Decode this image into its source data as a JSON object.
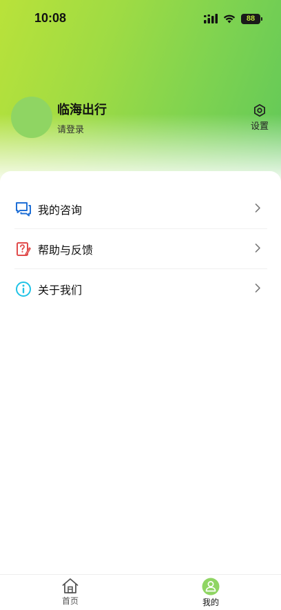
{
  "status_bar": {
    "time": "10:08",
    "battery": "88",
    "icons": [
      "cellular-signal-icon",
      "wifi-icon",
      "battery-icon"
    ]
  },
  "profile": {
    "name": "临海出行",
    "login_prompt": "请登录",
    "avatar_color": "#8fd563"
  },
  "settings": {
    "label": "设置",
    "icon": "gear-icon"
  },
  "menu": {
    "items": [
      {
        "label": "我的咨询",
        "icon": "chat-icon",
        "icon_color": "#1f6fd6"
      },
      {
        "label": "帮助与反馈",
        "icon": "feedback-icon",
        "icon_color": "#e04a4a"
      },
      {
        "label": "关于我们",
        "icon": "info-icon",
        "icon_color": "#1fc3e6"
      }
    ]
  },
  "tab_bar": {
    "tabs": [
      {
        "label": "首页",
        "icon": "home-icon",
        "active": false
      },
      {
        "label": "我的",
        "icon": "profile-icon",
        "active": true
      }
    ]
  },
  "colors": {
    "brand": "#8fd563",
    "gradient_start": "#b9e23a",
    "gradient_end": "#5ec75a"
  }
}
